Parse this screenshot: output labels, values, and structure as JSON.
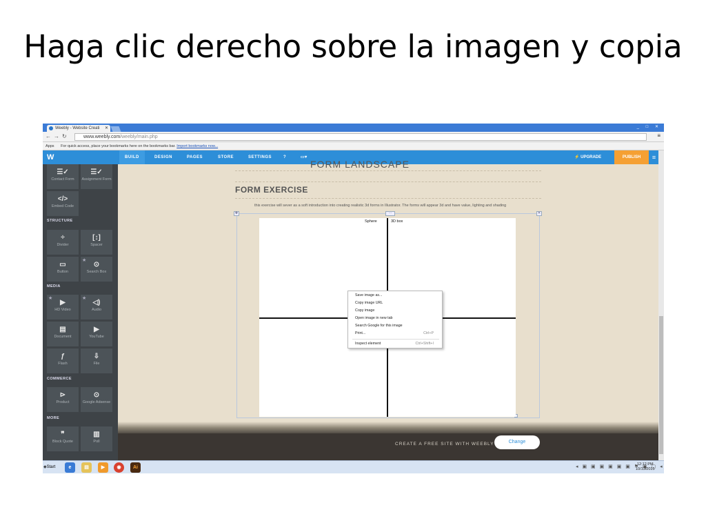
{
  "slide": {
    "title": "Haga clic derecho sobre la imagen y copia"
  },
  "browser": {
    "tab_title": "Weebly - Website Creati",
    "url_domain": "www.weebly.com",
    "url_path": "/weebly/main.php",
    "bookmarks": {
      "apps": "Apps",
      "text": "For quick access, place your bookmarks here on the bookmarks bar.",
      "link": "Import bookmarks now..."
    }
  },
  "weebly": {
    "nav": [
      "BUILD",
      "DESIGN",
      "PAGES",
      "STORE",
      "SETTINGS"
    ],
    "upgrade": "UPGRADE",
    "publish": "PUBLISH",
    "sidebar": {
      "tiles": {
        "contact_form": "Contact Form",
        "assignment_form": "Assignment Form",
        "embed_code": "Embed Code",
        "divider": "Divider",
        "spacer": "Spacer",
        "button": "Button",
        "search_box": "Search Box",
        "hd_video": "HD Video",
        "audio": "Audio",
        "document": "Document",
        "youtube": "YouTube",
        "flash": "Flash",
        "file": "File",
        "product": "Product",
        "google_adsense": "Google Adsense",
        "block_quote": "Block Quote",
        "poll": "Poll"
      },
      "sections": {
        "structure": "STRUCTURE",
        "media": "MEDIA",
        "commerce": "COMMERCE",
        "more": "MORE"
      }
    },
    "canvas": {
      "prev_title": "FORM LANDSCAPE",
      "title": "FORM EXERCISE",
      "description": "this exercise will sever as a soft introduction into creating realistic 3d forms in Illustrator.  The forms will appear 3d and have value, lighting and shading",
      "image_labels": [
        "Sphere",
        "3D box"
      ]
    },
    "context_menu": [
      {
        "label": "Save image as...",
        "shortcut": ""
      },
      {
        "label": "Copy image URL",
        "shortcut": ""
      },
      {
        "label": "Copy image",
        "shortcut": ""
      },
      {
        "label": "Open image in new tab",
        "shortcut": ""
      },
      {
        "label": "Search Google for this image",
        "shortcut": ""
      },
      {
        "label": "Print...",
        "shortcut": "Ctrl+P"
      },
      {
        "label": "Inspect element",
        "shortcut": "Ctrl+Shift+I"
      }
    ],
    "footer": {
      "text": "CREATE A FREE SITE WITH WEEBLY",
      "button": "Change"
    }
  },
  "taskbar": {
    "start": "Start",
    "time": "12:12 PM",
    "date": "10/13/2015"
  }
}
